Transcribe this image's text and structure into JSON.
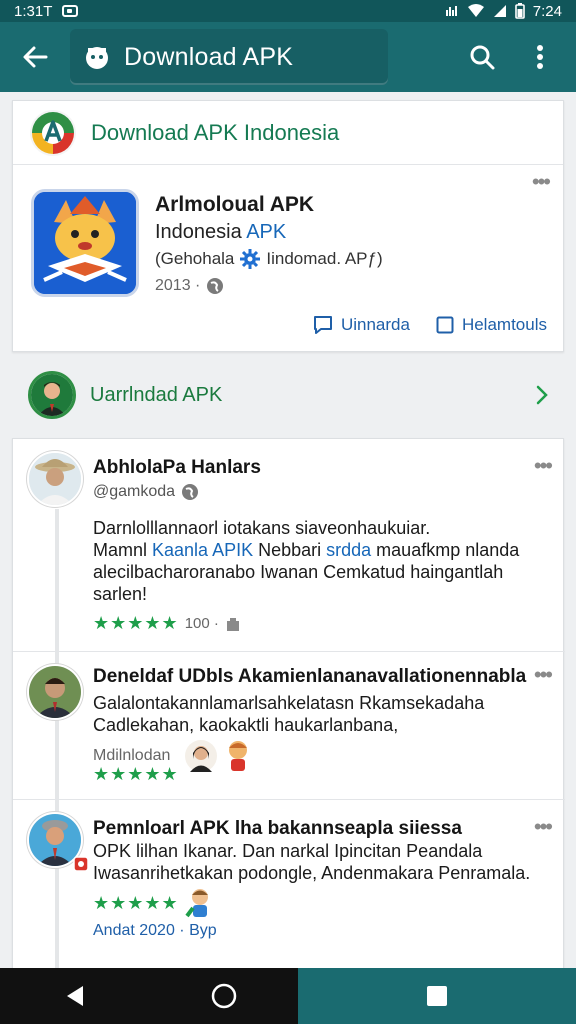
{
  "status_bar": {
    "time_left": "1:31T",
    "time_right": "7:24"
  },
  "app_bar": {
    "title": "Download APK"
  },
  "header_card": {
    "title": "Download APK Indonesia",
    "app": {
      "name": "Arlmoloual APK",
      "subtitle_prefix": "Indonesia",
      "subtitle_highlight": "APK",
      "developer_prefix": "(Gehohala",
      "developer_suffix": "Iindomad. APƒ)",
      "year": "2013 ·"
    },
    "actions": [
      {
        "label": "Uinnarda"
      },
      {
        "label": "Helamtouls"
      }
    ]
  },
  "developer_row": {
    "name": "Uarrlndad APK"
  },
  "reviews": [
    {
      "name": "AbhlolaPa Hanlars",
      "handle": "@gamkoda",
      "body": [
        {
          "text": "Darnlolllannaorl iotakans siaveonhaukuiar."
        },
        {
          "pre": "Mamnl ",
          "hl": "Kaanla APIK",
          "mid": " Nebbari ",
          "hl2": "srdda",
          "post": " mauafkmp nlanda"
        },
        {
          "text": "alecilbacharoranabo Iwanan Cemkatud haingantlah sarlen!"
        }
      ],
      "stars": "★★★★★",
      "count": "100 ·"
    },
    {
      "name": "Deneldaf UDbls Akamienlananavallationennabla",
      "body": [
        {
          "text": "Galalontakannlamarlsahkelatasn Rkamsekadaha"
        },
        {
          "text": "Cadlekahan, kaokaktli haukarlanbana,"
        }
      ],
      "meta_text": "Mdilnlodan",
      "stars": "★★★★★"
    },
    {
      "name": "Pemnloarl APK lha bakannseapla siiessa",
      "body": [
        {
          "text": "OPK lilhan Ikanar. Dan narkal Ipincitan Peandala"
        },
        {
          "text": "Iwasanrihetkakan podongle, Andenmakara Penramala."
        }
      ],
      "stars": "★★★★★",
      "footer": "Andat 2020 · Byp"
    }
  ],
  "colors": {
    "primary": "#1a6b70",
    "accent_green": "#1e9e4a",
    "link_blue": "#1f5fa8"
  }
}
